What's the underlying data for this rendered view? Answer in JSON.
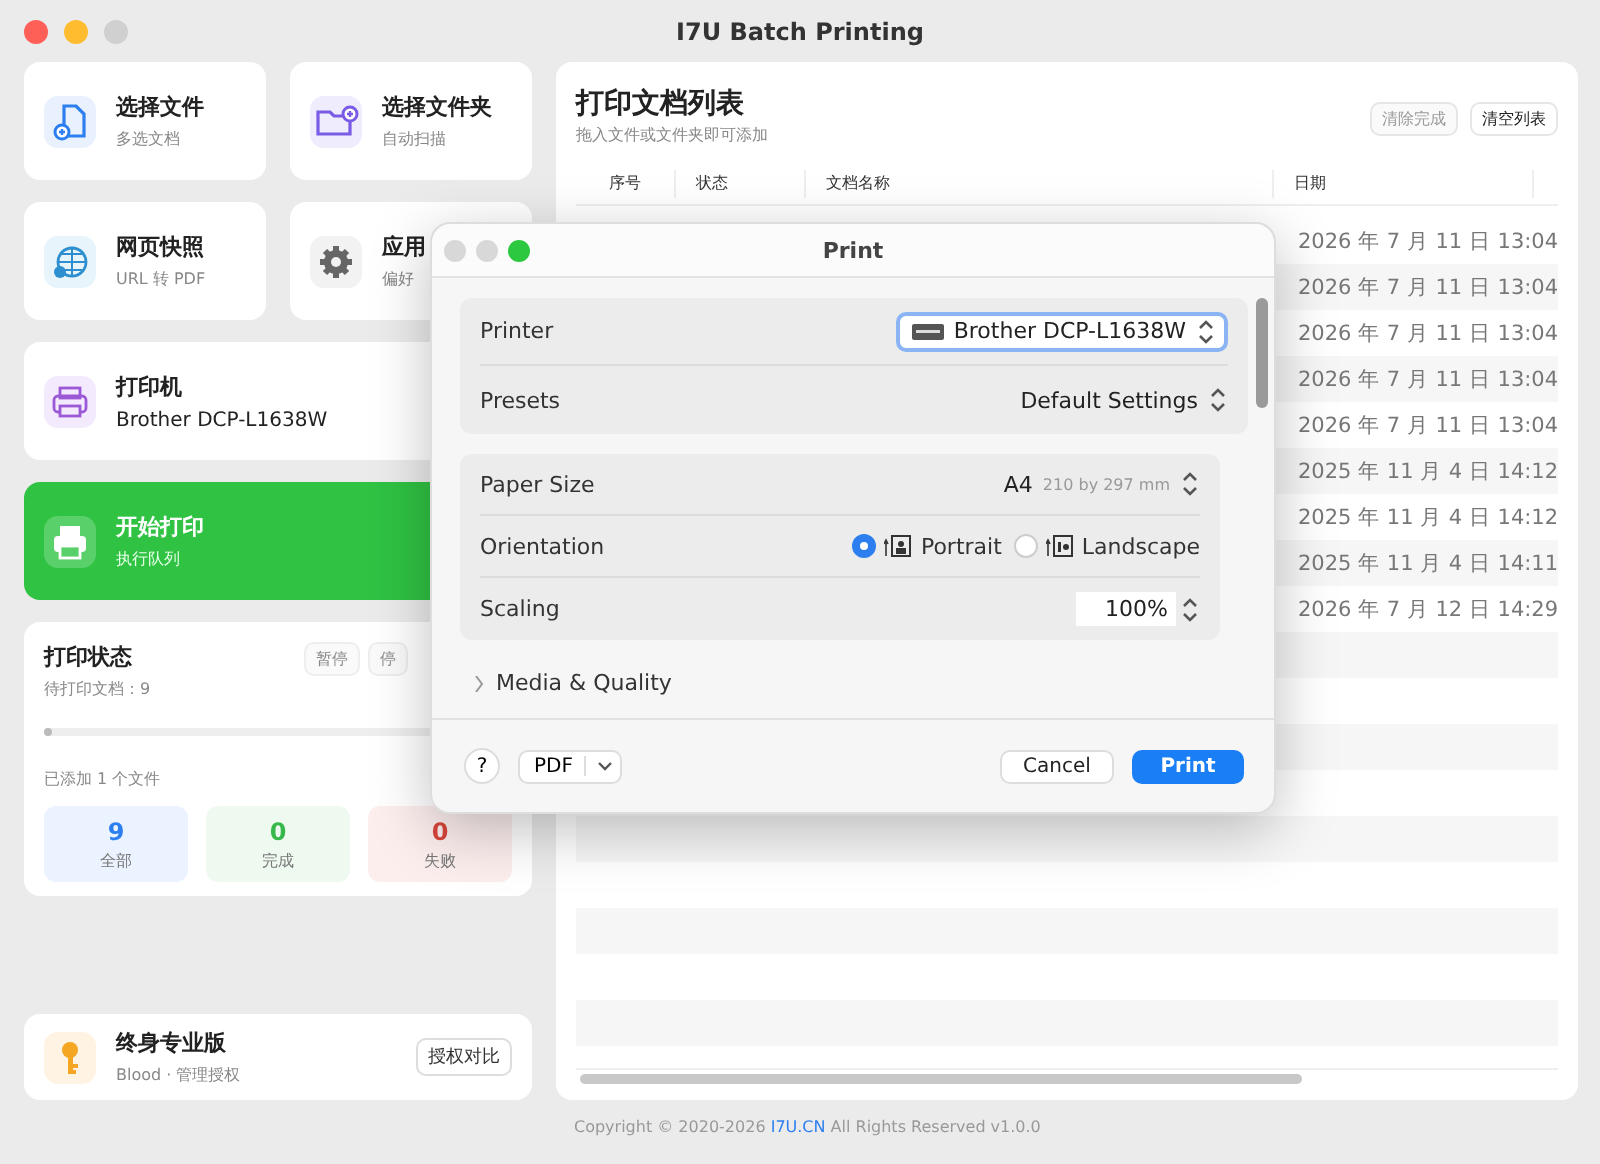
{
  "window": {
    "title": "I7U Batch Printing"
  },
  "actions": [
    {
      "kind": "file",
      "title": "选择文件",
      "subtitle": "多选文档"
    },
    {
      "kind": "folder",
      "title": "选择文件夹",
      "subtitle": "自动扫描"
    },
    {
      "kind": "web",
      "title": "网页快照",
      "subtitle": "URL 转 PDF"
    },
    {
      "kind": "settings",
      "title": "应用",
      "subtitle": "偏好"
    }
  ],
  "printer_card": {
    "label": "打印机",
    "name": "Brother DCP-L1638W"
  },
  "start_card": {
    "title": "开始打印",
    "subtitle": "执行队列"
  },
  "status": {
    "title": "打印状态",
    "pending": "待打印文档：9",
    "buttons": [
      "暂停",
      "停"
    ],
    "progress": {
      "level": 0
    },
    "added": "已添加 1 个文件",
    "stats": [
      {
        "kind": "all",
        "value": "9",
        "label": "全部"
      },
      {
        "kind": "done",
        "value": "0",
        "label": "完成"
      },
      {
        "kind": "failed",
        "value": "0",
        "label": "失败"
      }
    ]
  },
  "license": {
    "title": "终身专业版",
    "subtitle": "Blood · 管理授权",
    "button": "授权对比"
  },
  "list": {
    "title": "打印文档列表",
    "subtitle": "拖入文件或文件夹即可添加",
    "buttons": [
      {
        "label": "清除完成",
        "disabled": true
      },
      {
        "label": "清空列表",
        "disabled": false
      }
    ],
    "columns": [
      "序号",
      "状态",
      "文档名称",
      "日期"
    ],
    "rows": [
      {
        "date": "2026 年 7 月 11 日 13:04"
      },
      {
        "date": "2026 年 7 月 11 日 13:04"
      },
      {
        "date": "2026 年 7 月 11 日 13:04"
      },
      {
        "date": "2026 年 7 月 11 日 13:04"
      },
      {
        "date": "2026 年 7 月 11 日 13:04"
      },
      {
        "date": "2025 年 11 月 4 日 14:12"
      },
      {
        "date": "2025 年 11 月 4 日 14:12"
      },
      {
        "date": "2025 年 11 月 4 日 14:11"
      },
      {
        "date": "2026 年 7 月 12 日 14:29"
      }
    ]
  },
  "footer": {
    "before": "Copyright © 2020-2026",
    "link": "I7U.CN",
    "after": "All Rights Reserved v1.0.0"
  },
  "print_dialog": {
    "title": "Print",
    "printer": {
      "label": "Printer",
      "value": "Brother DCP-L1638W"
    },
    "presets": {
      "label": "Presets",
      "value": "Default Settings"
    },
    "paper_size": {
      "label": "Paper Size",
      "value": "A4",
      "detail": "210 by 297 mm"
    },
    "orientation": {
      "label": "Orientation",
      "options": [
        {
          "label": "Portrait",
          "selected": true
        },
        {
          "label": "Landscape",
          "selected": false
        }
      ]
    },
    "scaling": {
      "label": "Scaling",
      "value": "100%"
    },
    "section": {
      "label": "Media & Quality",
      "expanded": false
    },
    "help": "?",
    "pdf": "PDF",
    "cancel": "Cancel",
    "print": "Print"
  }
}
